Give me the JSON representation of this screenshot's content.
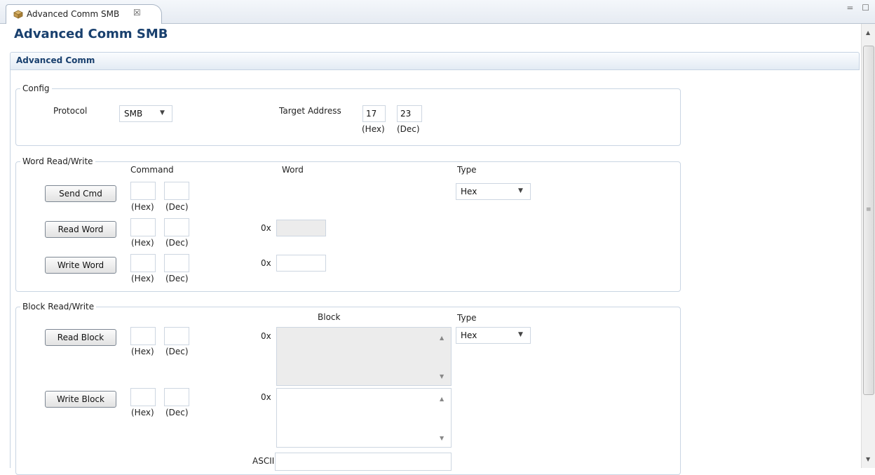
{
  "tab": {
    "label": "Advanced Comm SMB",
    "close": "☒",
    "window_controls": "= ☐"
  },
  "form": {
    "title": "Advanced Comm SMB",
    "section": "Advanced Comm"
  },
  "config": {
    "legend": "Config",
    "protocol_label": "Protocol",
    "protocol_value": "SMB",
    "target_label": "Target Address",
    "target_hex": "17",
    "target_dec": "23",
    "hex_caption": "(Hex)",
    "dec_caption": "(Dec)"
  },
  "word": {
    "legend": "Word Read/Write",
    "command_header": "Command",
    "word_header": "Word",
    "type_header": "Type",
    "type_value": "Hex",
    "send_cmd": "Send Cmd",
    "read_word": "Read Word",
    "write_word": "Write Word",
    "prefix": "0x",
    "hex_caption": "(Hex)",
    "dec_caption": "(Dec)"
  },
  "block": {
    "legend": "Block Read/Write",
    "block_header": "Block",
    "type_header": "Type",
    "type_value": "Hex",
    "read_block": "Read Block",
    "write_block": "Write Block",
    "prefix": "0x",
    "ascii_label": "ASCII",
    "hex_caption": "(Hex)",
    "dec_caption": "(Dec)"
  },
  "icons": {
    "tab": "component-icon",
    "dropdown": "chevron-down-icon",
    "scroll_up": "scroll-up-icon",
    "scroll_down": "scroll-down-icon"
  },
  "colors": {
    "title": "#19406e",
    "border": "#c9d5e3",
    "readonly_fill": "#ececec"
  }
}
